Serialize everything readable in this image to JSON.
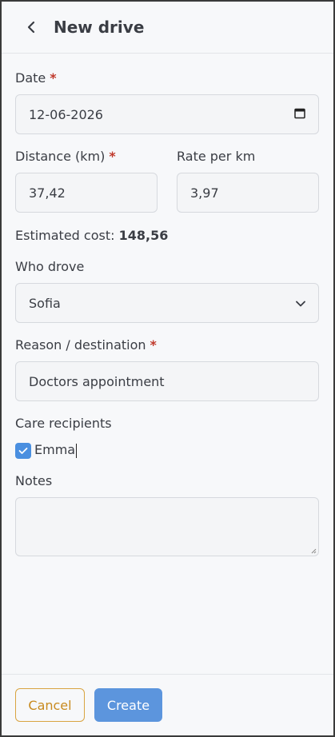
{
  "header": {
    "title": "New drive"
  },
  "date": {
    "label": "Date",
    "required": "*",
    "value": "12-06-2026"
  },
  "distance": {
    "label": "Distance (km)",
    "required": "*",
    "value": "37,42"
  },
  "rate": {
    "label": "Rate per km",
    "value": "3,97"
  },
  "estimated": {
    "label": "Estimated cost:",
    "value": "148,56"
  },
  "who": {
    "label": "Who drove",
    "value": "Sofia"
  },
  "reason": {
    "label": "Reason / destination",
    "required": "*",
    "value": "Doctors appointment"
  },
  "care": {
    "label": "Care recipients",
    "items": [
      {
        "label": "Emma",
        "checked": true
      }
    ]
  },
  "notes": {
    "label": "Notes",
    "value": ""
  },
  "footer": {
    "cancel_label": "Cancel",
    "create_label": "Create"
  },
  "colors": {
    "accent": "#5c95dd",
    "cancel": "#c88a1e",
    "required": "#c0392b"
  }
}
